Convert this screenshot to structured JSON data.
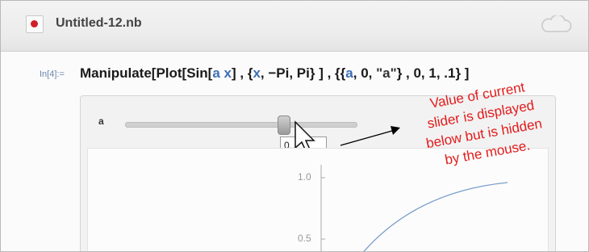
{
  "window": {
    "title": "Untitled-12.nb"
  },
  "cell": {
    "input_label": "In[4]:=",
    "code": {
      "part1": "Manipulate[Plot[Sin[",
      "var_a": "a",
      "part2": " ",
      "var_x": "x",
      "part3": "] , {",
      "var_x2": "x",
      "part4": ", −Pi, Pi} ] , {{",
      "var_a2": "a",
      "part5": ", 0, ",
      "str_a": "\"a\"",
      "part6": "} , 0, 1, .1} ]"
    }
  },
  "manipulate": {
    "slider_label": "a",
    "slider_value_fraction": 0.7,
    "value_popup_text": "0.",
    "value_popup_tail": "..."
  },
  "plot": {
    "y_ticks": [
      "1.0",
      "0.5"
    ]
  },
  "annotation": {
    "line1": "Value of current",
    "line2": "slider is displayed",
    "line3": "below but is hidden",
    "line4": "by the mouse.",
    "color": "#e31b1b"
  },
  "icons": [
    "notebook-icon",
    "cloud-icon",
    "mouse-cursor-icon"
  ]
}
